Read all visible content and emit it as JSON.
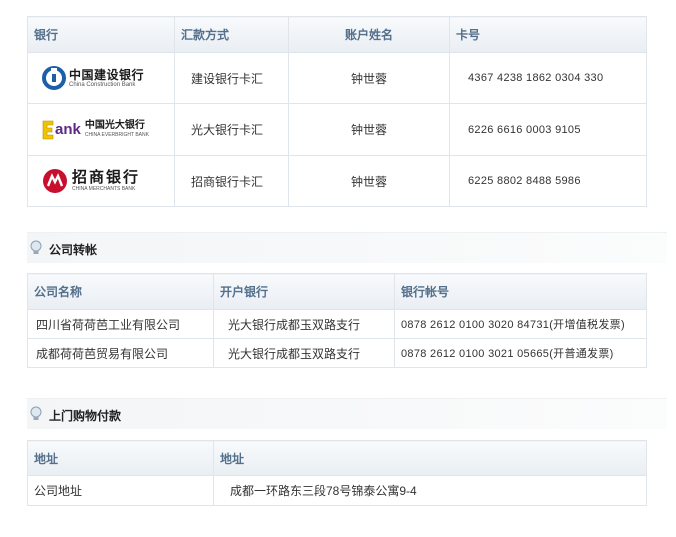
{
  "bank_table": {
    "headers": [
      "银行",
      "汇款方式",
      "账户姓名",
      "卡号"
    ],
    "rows": [
      {
        "logo": "ccb-logo",
        "logo_cn": "中国建设银行",
        "logo_en": "China Construction Bank",
        "method": "建设银行卡汇",
        "name": "钟世蓉",
        "card": "4367 4238 1862 0304 330"
      },
      {
        "logo": "ceb-logo",
        "logo_cn": "中国光大银行",
        "logo_en": "CHINA EVERBRIGHT BANK",
        "method": "光大银行卡汇",
        "name": "钟世蓉",
        "card": "6226 6616 0003 9105"
      },
      {
        "logo": "cmb-logo",
        "logo_cn": "招商银行",
        "logo_en": "CHINA MERCHANTS BANK",
        "method": "招商银行卡汇",
        "name": "钟世蓉",
        "card": "6225 8802 8488 5986"
      }
    ]
  },
  "company_section": {
    "title": "公司转帐",
    "headers": [
      "公司名称",
      "开户银行",
      "银行帐号"
    ],
    "rows": [
      {
        "company": "四川省荷荷芭工业有限公司",
        "bank": "光大银行成都玉双路支行",
        "account": "0878 2612 0100 3020 84731(开增值税发票)"
      },
      {
        "company": "成都荷荷芭贸易有限公司",
        "bank": "光大银行成都玉双路支行",
        "account": "0878 2612 0100 3021 05665(开普通发票)"
      }
    ]
  },
  "visit_section": {
    "title": "上门购物付款",
    "headers": [
      "地址",
      "地址"
    ],
    "rows": [
      {
        "label": "公司地址",
        "address": "成都一环路东三段78号锦泰公寓9-4"
      }
    ]
  },
  "colors": {
    "header_text": "#54708c",
    "border": "#dfe5ea",
    "ccb_blue": "#1c5ea8",
    "ceb_purple": "#5b2a86",
    "ceb_yellow": "#f0c400",
    "cmb_red": "#c8102e"
  }
}
